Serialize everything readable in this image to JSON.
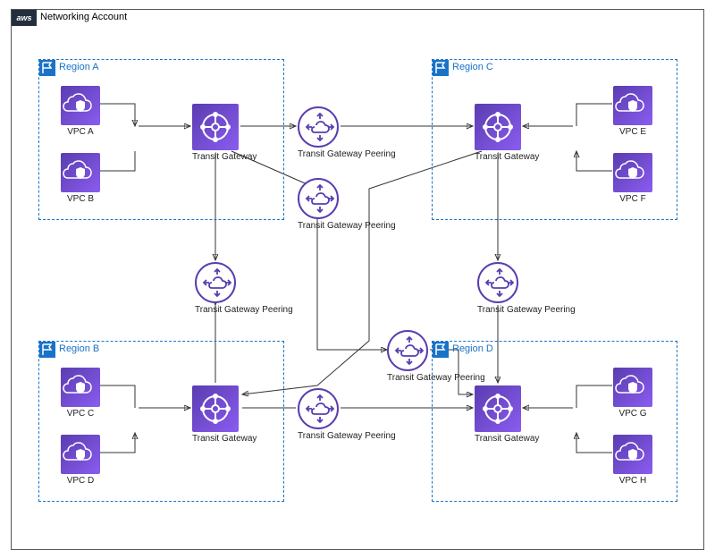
{
  "container": {
    "title": "Networking Account",
    "badge": "aws"
  },
  "regions": {
    "a": {
      "title": "Region A"
    },
    "b": {
      "title": "Region B"
    },
    "c": {
      "title": "Region C"
    },
    "d": {
      "title": "Region D"
    }
  },
  "vpc": {
    "a": "VPC A",
    "b": "VPC B",
    "c": "VPC C",
    "d": "VPC D",
    "e": "VPC E",
    "f": "VPC F",
    "g": "VPC G",
    "h": "VPC H"
  },
  "tgw": {
    "label": "Transit Gateway"
  },
  "peer": {
    "label": "Transit Gateway Peering"
  },
  "icons": {
    "vpc": "cloud-shield-icon",
    "tgw": "hub-spoke-icon",
    "peer": "cloud-arrows-icon",
    "region": "flag-icon",
    "aws": "aws-logo-icon"
  }
}
